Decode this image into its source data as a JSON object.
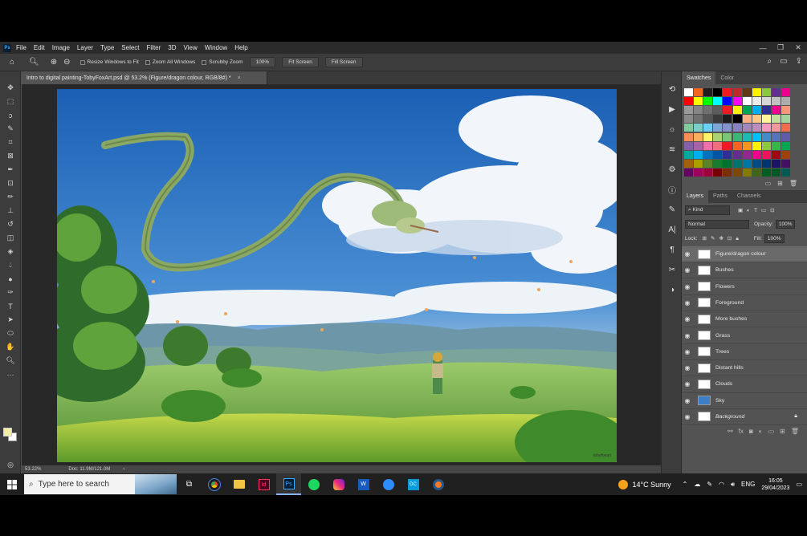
{
  "app": {
    "logo": "Ps",
    "menu": [
      "File",
      "Edit",
      "Image",
      "Layer",
      "Type",
      "Select",
      "Filter",
      "3D",
      "View",
      "Window",
      "Help"
    ]
  },
  "options": {
    "resize_windows": "Resize Windows to Fit",
    "zoom_all": "Zoom All Windows",
    "scrubby": "Scrubby Zoom",
    "zoom_value": "100%",
    "fit_screen": "Fit Screen",
    "fill_screen": "Fill Screen"
  },
  "document": {
    "tab_title": "Intro to digital painting-TobyFoxArt.psd @ 53.2% (Figure/dragon colour, RGB/8#) *",
    "tab_close": "×",
    "zoom": "53.22%",
    "doc_size": "Doc: 11.9M/121.0M",
    "signature": "tobyfoxart"
  },
  "swatches": {
    "tabs": [
      "Swatches",
      "Color"
    ],
    "rows": [
      [
        "#ffffff",
        "#f26522",
        "#231f20",
        "#000000",
        "#ed1c24",
        "#c1272d",
        "#603813",
        "#fff200",
        "#8dc63f",
        "#662d91",
        "#ec008c"
      ],
      [
        "#ff0000",
        "#ffff00",
        "#00ff00",
        "#00ffff",
        "#0000ff",
        "#ff00ff",
        "#ffffff",
        "#ebebeb",
        "#d7d7d7",
        "#c2c2c2",
        "#adadad"
      ],
      [
        "#999999",
        "#858585",
        "#707070",
        "#5c5c5c",
        "#ed1c24",
        "#fff200",
        "#00a651",
        "#00aeef",
        "#2e3192",
        "#ec008c",
        "#f7977a"
      ],
      [
        "#898989",
        "#707070",
        "#555555",
        "#3a3a3a",
        "#1d1d1d",
        "#000000",
        "#f9ad81",
        "#fdc68a",
        "#fff79a",
        "#c4df9b",
        "#a3d39c"
      ],
      [
        "#82ca9d",
        "#7bcdc8",
        "#6ecff6",
        "#7ea7d8",
        "#8493ca",
        "#8882be",
        "#a187be",
        "#bc8dbf",
        "#f49ac1",
        "#f5989d",
        "#f26c4f"
      ],
      [
        "#f68e56",
        "#fbaf5d",
        "#fff467",
        "#acd373",
        "#7cc576",
        "#3bb878",
        "#1abbb4",
        "#00bff3",
        "#438ccb",
        "#5574b9",
        "#605ca8"
      ],
      [
        "#855fa8",
        "#a763a8",
        "#f06ea9",
        "#f26d7d",
        "#ed1c24",
        "#f26522",
        "#f7941d",
        "#fff200",
        "#8dc63f",
        "#39b54a",
        "#00a651"
      ],
      [
        "#00a99d",
        "#00aeef",
        "#0072bc",
        "#0054a6",
        "#2e3192",
        "#662d91",
        "#92278f",
        "#ec008c",
        "#ed145b",
        "#9e0b0f",
        "#a0410d"
      ],
      [
        "#a36209",
        "#aba000",
        "#598527",
        "#197b30",
        "#007236",
        "#00746b",
        "#0076a3",
        "#004b80",
        "#003471",
        "#1b1464",
        "#440e62"
      ],
      [
        "#630460",
        "#9e005d",
        "#9e0039",
        "#790000",
        "#7b2e00",
        "#7d4900",
        "#827b00",
        "#406618",
        "#005e20",
        "#005826",
        "#005952"
      ]
    ]
  },
  "layers": {
    "tabs": [
      "Layers",
      "Paths",
      "Channels"
    ],
    "kind": "Kind",
    "blend_mode": "Normal",
    "opacity_label": "Opacity:",
    "opacity": "100%",
    "lock_label": "Lock:",
    "fill_label": "Fill:",
    "fill": "100%",
    "items": [
      {
        "name": "Figure/dragon colour",
        "selected": true
      },
      {
        "name": "Bushes"
      },
      {
        "name": "Flowers"
      },
      {
        "name": "Foreground"
      },
      {
        "name": "More bushes"
      },
      {
        "name": "Grass"
      },
      {
        "name": "Trees"
      },
      {
        "name": "Distant hills"
      },
      {
        "name": "Clouds"
      },
      {
        "name": "Sky"
      },
      {
        "name": "Background",
        "italic": true,
        "locked": true
      }
    ]
  },
  "taskbar": {
    "search_placeholder": "Type here to search",
    "weather": "14°C  Sunny",
    "lang": "ENG",
    "time": "16:05",
    "date": "29/04/2023"
  }
}
